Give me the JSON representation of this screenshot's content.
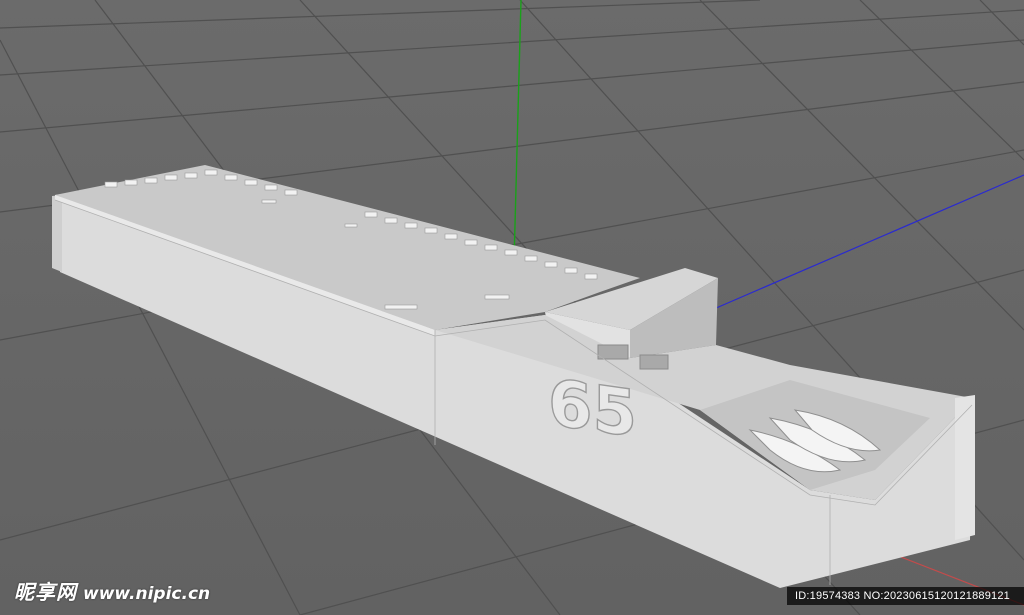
{
  "viewport": {
    "background_color": "#676767",
    "grid_line_color": "#4f4f4f",
    "y_axis_color": "#1aa11a",
    "x_axis_color": "#c44b4b",
    "z_axis_color": "#2a2ad0",
    "model_color": "#e6e6e6"
  },
  "model": {
    "hull_number": "65"
  },
  "watermark": {
    "site_name_cn": "昵享网",
    "site_url": "www.nipic.cn",
    "id_text": "ID:19574383 NO:20230615120121889121"
  }
}
